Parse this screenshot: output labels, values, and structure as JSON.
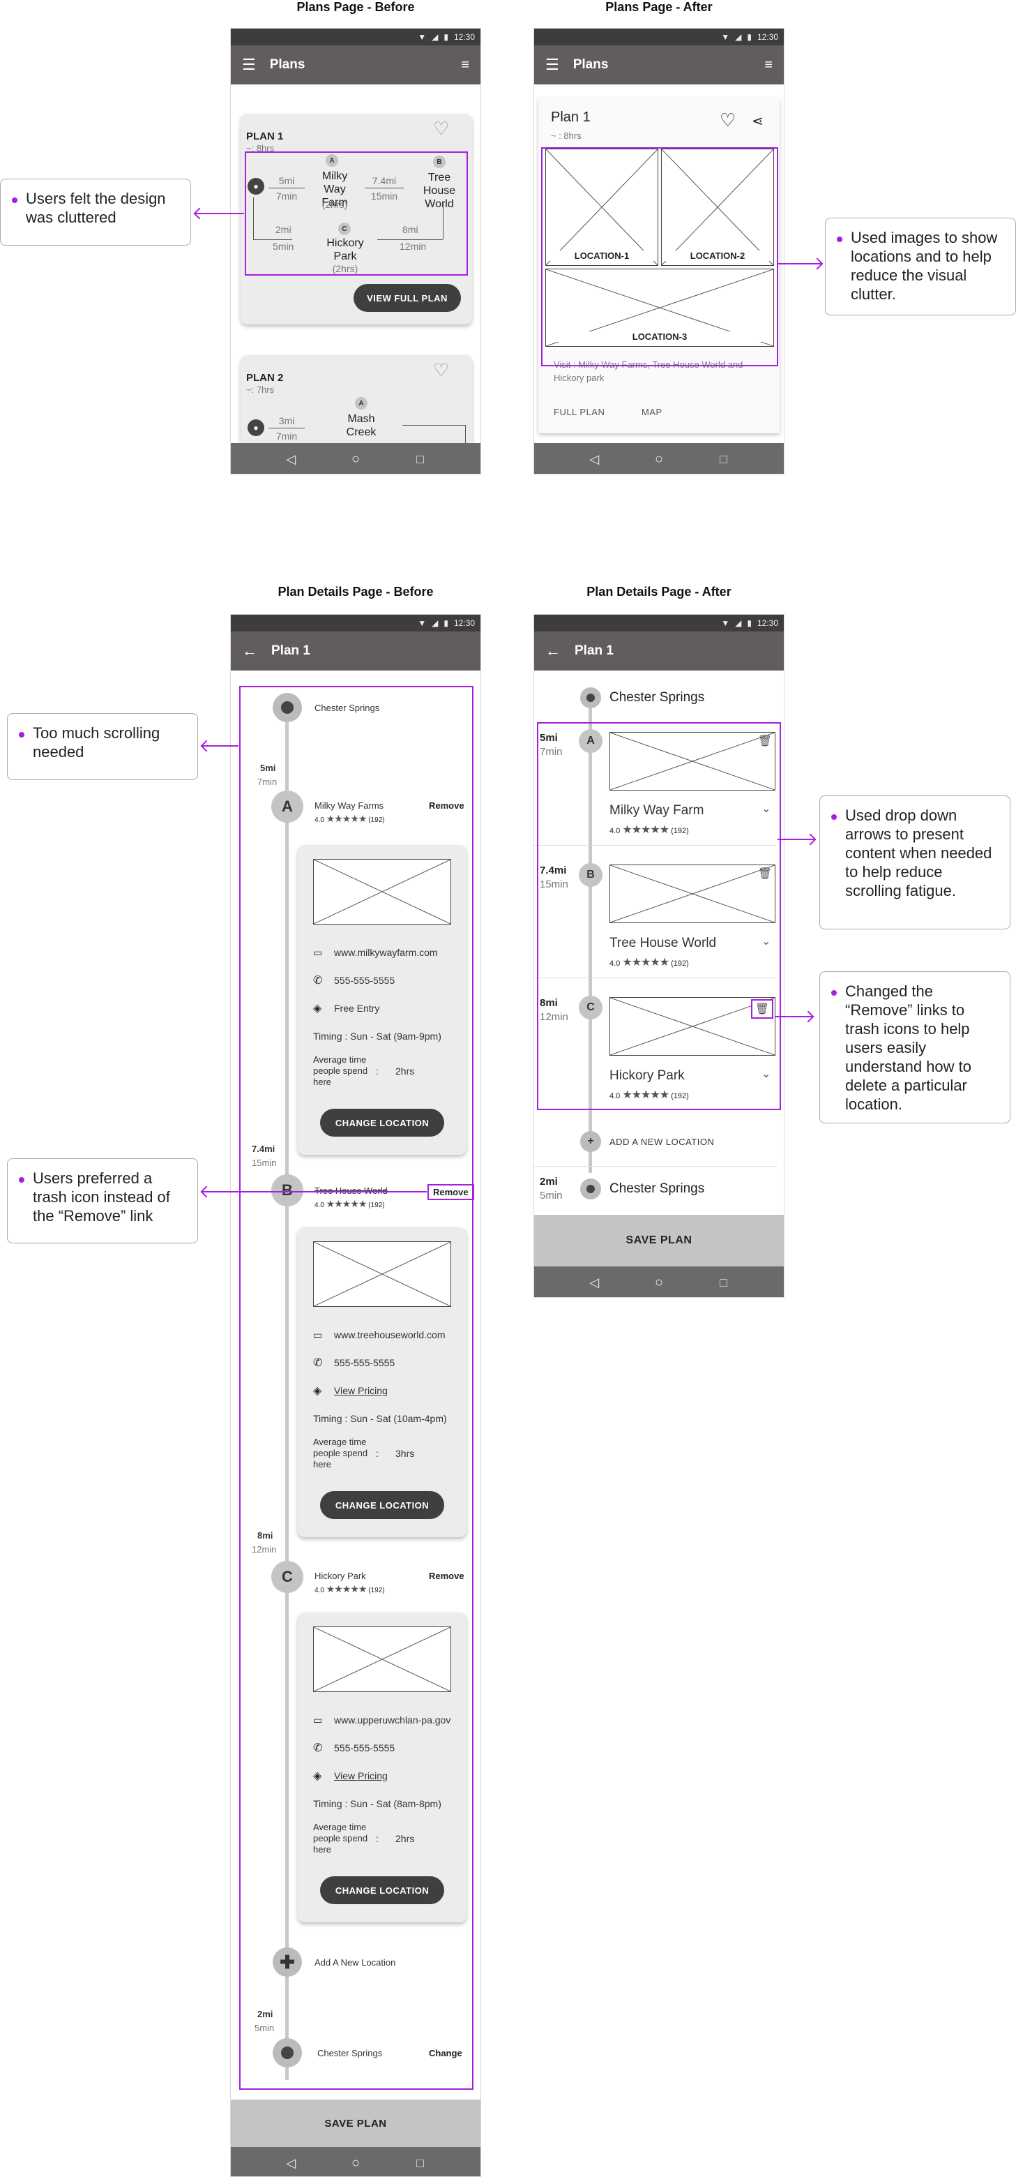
{
  "titles": {
    "plans_before": "Plans Page - Before",
    "plans_after": "Plans Page - After",
    "details_before": "Plan Details Page - Before",
    "details_after": "Plan Details Page - After"
  },
  "status_time": "12:30",
  "plans_title": "Plans",
  "plan1": {
    "title_caps": "PLAN 1",
    "duration_caps": "~: 8hrs",
    "title": "Plan 1",
    "duration": "~ : 8hrs",
    "loc_a": "Milky Way Farm",
    "loc_a_time": "(2hrs)",
    "loc_b": "Tree House World",
    "loc_c": "Hickory Park",
    "loc_c_time": "(2hrs)",
    "seg1_dist": "5mi",
    "seg1_time": "7min",
    "seg2_dist": "7.4mi",
    "seg2_time": "15min",
    "seg3_dist": "8mi",
    "seg3_time": "12min",
    "seg4_dist": "2mi",
    "seg4_time": "5min",
    "view_full": "VIEW FULL PLAN"
  },
  "plan2": {
    "title_caps": "PLAN 2",
    "duration_caps": "~: 7hrs",
    "loc_a": "Mash Creek",
    "seg1_dist": "3mi",
    "seg1_time": "7min"
  },
  "after_card": {
    "loc1": "LOCATION-1",
    "loc2": "LOCATION-2",
    "loc3": "LOCATION-3",
    "visit": "Visit : Milky Way Farms, Tree House World and Hickory park",
    "full_plan": "FULL PLAN",
    "map": "MAP"
  },
  "callouts": {
    "cluttered": "Users felt the design was cluttered",
    "images": "Used images to show locations and to help reduce the visual clutter.",
    "scrolling": "Too much scrolling needed",
    "trash_pref": "Users preferred a trash icon instead of the “Remove” link",
    "dropdown": "Used drop down arrows to present content when needed to help reduce scrolling fatigue.",
    "remove_change": "Changed the “Remove” links to trash icons to help users easily understand how to delete a particular location."
  },
  "details": {
    "start": "Chester Springs",
    "a_name": "Milky Way Farms",
    "a_name_after": "Milky Way Farm",
    "b_name": "Tree House World",
    "c_name": "Hickory Park",
    "rating": "4.0",
    "reviews": "(192)",
    "remove": "Remove",
    "change": "Change",
    "a_site": "www.milkywayfarm.com",
    "b_site": "www.treehouseworld.com",
    "c_site": "www.upperuwchlan-pa.gov",
    "phone": "555-555-5555",
    "a_price": "Free Entry",
    "view_pricing": "View Pricing",
    "a_timing": "Timing : Sun - Sat (9am-9pm)",
    "b_timing": "Timing : Sun - Sat (10am-4pm)",
    "c_timing": "Timing : Sun - Sat (8am-8pm)",
    "avg_label": "Average time people spend here",
    "colon": ":",
    "a_avg": "2hrs",
    "b_avg": "3hrs",
    "c_avg": "2hrs",
    "change_location": "CHANGE LOCATION",
    "add_new": "Add A New Location",
    "add_new_caps": "ADD A NEW LOCATION",
    "save_plan": "SAVE PLAN",
    "letters": [
      "A",
      "B",
      "C"
    ]
  },
  "colors": {
    "accent": "#a41fe0",
    "appbar": "#615d5d",
    "status": "#3d3d3d",
    "nav": "#6a6a6a",
    "card": "#ececec"
  }
}
